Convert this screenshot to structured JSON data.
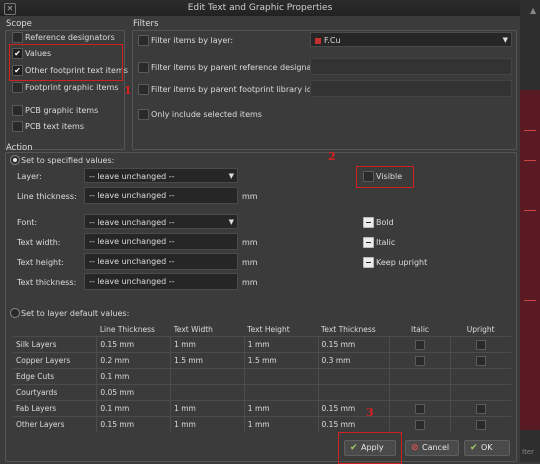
{
  "window": {
    "title": "Edit Text and Graphic Properties"
  },
  "scope": {
    "title": "Scope",
    "items": [
      {
        "label": "Reference designators",
        "checked": false
      },
      {
        "label": "Values",
        "checked": true
      },
      {
        "label": "Other footprint text items",
        "checked": true
      },
      {
        "label": "Footprint graphic items",
        "checked": false
      },
      {
        "label": "PCB graphic items",
        "checked": false
      },
      {
        "label": "PCB text items",
        "checked": false
      }
    ]
  },
  "filters": {
    "title": "Filters",
    "layer_label": "Filter items by layer:",
    "layer_value": "F.Cu",
    "layer_color": "#c23030",
    "ref_label": "Filter items by parent reference designator:",
    "ref_value": "",
    "lib_label": "Filter items by parent footprint library id:",
    "lib_value": "",
    "selected_label": "Only include selected items"
  },
  "action": {
    "title": "Action",
    "specified_label": "Set to specified values:",
    "layer_label": "Layer:",
    "layer_value": "-- leave unchanged --",
    "visible_label": "Visible",
    "line_thickness_label": "Line thickness:",
    "line_thickness_value": "-- leave unchanged --",
    "font_label": "Font:",
    "font_value": "-- leave unchanged --",
    "bold_label": "Bold",
    "text_width_label": "Text width:",
    "text_width_value": "-- leave unchanged --",
    "italic_label": "Italic",
    "text_height_label": "Text height:",
    "text_height_value": "-- leave unchanged --",
    "keep_upright_label": "Keep upright",
    "text_thickness_label": "Text thickness:",
    "text_thickness_value": "-- leave unchanged --",
    "unit": "mm",
    "defaults_label": "Set to layer default values:"
  },
  "defaults_table": {
    "headers": [
      "",
      "Line Thickness",
      "Text Width",
      "Text Height",
      "Text Thickness",
      "Italic",
      "Upright"
    ],
    "rows": [
      {
        "layer": "Silk Layers",
        "line": "0.15 mm",
        "width": "1 mm",
        "height": "1 mm",
        "thick": "0.15 mm",
        "checks": true
      },
      {
        "layer": "Copper Layers",
        "line": "0.2 mm",
        "width": "1.5 mm",
        "height": "1.5 mm",
        "thick": "0.3 mm",
        "checks": true
      },
      {
        "layer": "Edge Cuts",
        "line": "0.1 mm",
        "width": "",
        "height": "",
        "thick": "",
        "checks": false
      },
      {
        "layer": "Courtyards",
        "line": "0.05 mm",
        "width": "",
        "height": "",
        "thick": "",
        "checks": false
      },
      {
        "layer": "Fab Layers",
        "line": "0.1 mm",
        "width": "1 mm",
        "height": "1 mm",
        "thick": "0.15 mm",
        "checks": true
      },
      {
        "layer": "Other Layers",
        "line": "0.15 mm",
        "width": "1 mm",
        "height": "1 mm",
        "thick": "0.15 mm",
        "checks": true
      }
    ]
  },
  "buttons": {
    "apply": "Apply",
    "cancel": "Cancel",
    "ok": "OK"
  },
  "annotations": {
    "n1": "1",
    "n2": "2",
    "n3": "3"
  },
  "side": {
    "iter": "Iter"
  }
}
